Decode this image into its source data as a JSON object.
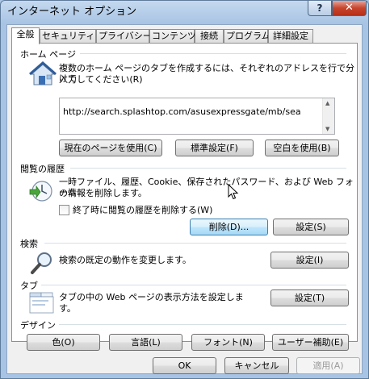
{
  "window": {
    "title": "インターネット オプション",
    "help_label": "?",
    "close_label": "✕"
  },
  "tabs": [
    {
      "label": "全般"
    },
    {
      "label": "セキュリティ"
    },
    {
      "label": "プライバシー"
    },
    {
      "label": "コンテンツ"
    },
    {
      "label": "接続"
    },
    {
      "label": "プログラム"
    },
    {
      "label": "詳細設定"
    }
  ],
  "home": {
    "title": "ホーム ページ",
    "desc_line1": "複数のホーム ページのタブを作成するには、それぞれのアドレスを行で分けて",
    "desc_line2": "入力してください(R)",
    "url": "http://search.splashtop.com/asusexpressgate/mb/sea",
    "btn_current": "現在のページを使用(C)",
    "btn_default": "標準設定(F)",
    "btn_blank": "空白を使用(B)"
  },
  "history": {
    "title": "閲覧の履歴",
    "desc_line1": "一時ファイル、履歴、Cookie、保存されたパスワード、および Web フォーム",
    "desc_line2": "の情報を削除します。",
    "checkbox_label": "終了時に閲覧の履歴を削除する(W)",
    "btn_delete": "削除(D)...",
    "btn_settings": "設定(S)"
  },
  "search": {
    "title": "検索",
    "desc": "検索の既定の動作を変更します。",
    "btn_settings": "設定(I)"
  },
  "tabsgroup": {
    "title": "タブ",
    "desc_line1": "タブの中の Web ページの表示方法を設定しま",
    "desc_line2": "す。",
    "btn_settings": "設定(T)"
  },
  "design": {
    "title": "デザイン",
    "btn_color": "色(O)",
    "btn_language": "言語(L)",
    "btn_font": "フォント(N)",
    "btn_accessibility": "ユーザー補助(E)"
  },
  "footer": {
    "ok": "OK",
    "cancel": "キャンセル",
    "apply": "適用(A)"
  },
  "colors": {
    "title_bar": "#b9d1ea",
    "close_red": "#c7442d",
    "hover_blue": "#3c7fb1"
  }
}
